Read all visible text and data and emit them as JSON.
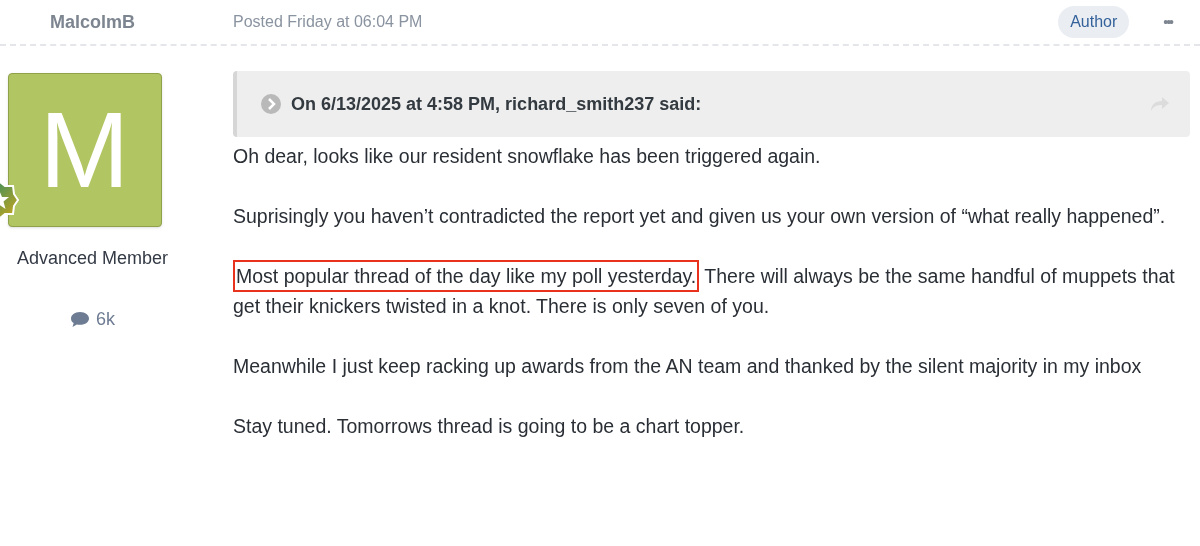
{
  "author": {
    "name": "MalcolmB",
    "avatar_letter": "M",
    "rank": "Advanced Member",
    "post_count": "6k"
  },
  "post": {
    "date": "Posted Friday at 06:04 PM",
    "badge": "Author",
    "menu": "•••",
    "quote": {
      "citation": "On 6/13/2025 at 4:58 PM, richard_smith237 said:"
    },
    "paragraphs": [
      {
        "text": "Oh dear, looks like our resident snowflake has been triggered again."
      },
      {
        "text": "Suprisingly you haven’t contradicted the report yet and given us your own version of “what really happened”."
      },
      {
        "highlight": "Most popular thread of the day like my poll yesterday.",
        "text": " There will always be the same handful of muppets that get their knickers twisted in a knot. There is only seven of you."
      },
      {
        "text": "Meanwhile I just keep racking up awards from the AN team and thanked by the silent majority in my inbox"
      },
      {
        "text": "Stay tuned. Tomorrows thread is going to be a chart topper."
      }
    ]
  }
}
